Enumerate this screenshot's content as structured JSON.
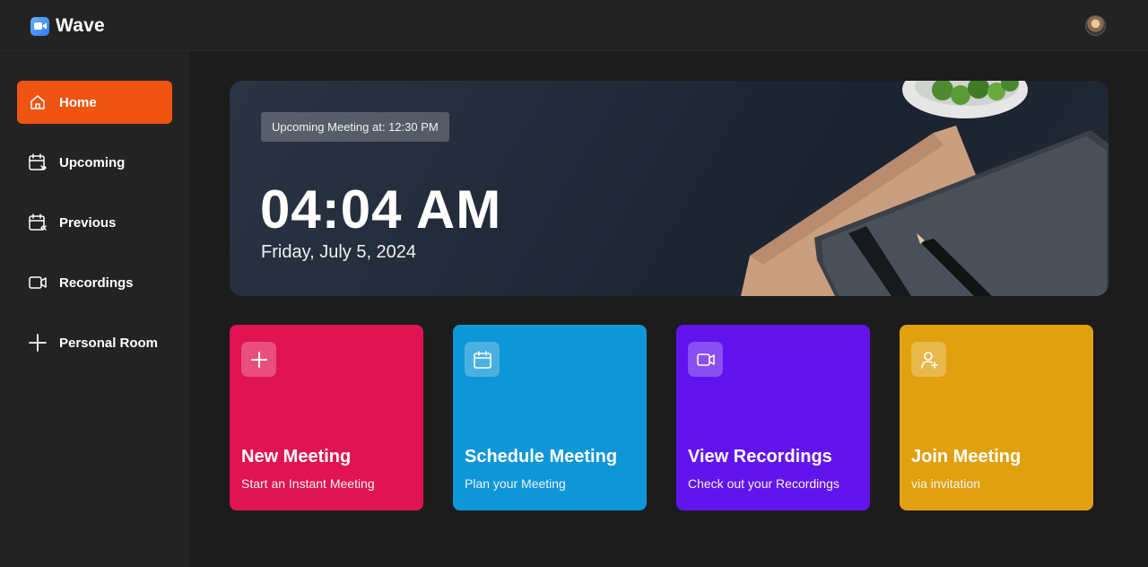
{
  "header": {
    "brand_name": "Wave"
  },
  "sidebar": {
    "items": [
      {
        "label": "Home",
        "icon": "home-icon",
        "active": true
      },
      {
        "label": "Upcoming",
        "icon": "calendar-upcoming-icon"
      },
      {
        "label": "Previous",
        "icon": "calendar-previous-icon"
      },
      {
        "label": "Recordings",
        "icon": "video-icon"
      },
      {
        "label": "Personal Room",
        "icon": "plus-icon"
      }
    ]
  },
  "hero": {
    "badge": "Upcoming Meeting at: 12:30 PM",
    "time": "04:04 AM",
    "date": "Friday, July 5, 2024"
  },
  "cards": [
    {
      "title": "New Meeting",
      "subtitle": "Start an Instant Meeting",
      "icon": "plus-icon",
      "color": "#e01353"
    },
    {
      "title": "Schedule Meeting",
      "subtitle": "Plan your Meeting",
      "icon": "calendar-icon",
      "color": "#0e96d9"
    },
    {
      "title": "View Recordings",
      "subtitle": "Check out your Recordings",
      "icon": "video-icon",
      "color": "#6214ee"
    },
    {
      "title": "Join Meeting",
      "subtitle": "via invitation",
      "icon": "user-add-icon",
      "color": "#e0a00f"
    }
  ],
  "colors": {
    "accent": "#ef5410",
    "background": "#1c1c1c",
    "surface": "#232323"
  }
}
